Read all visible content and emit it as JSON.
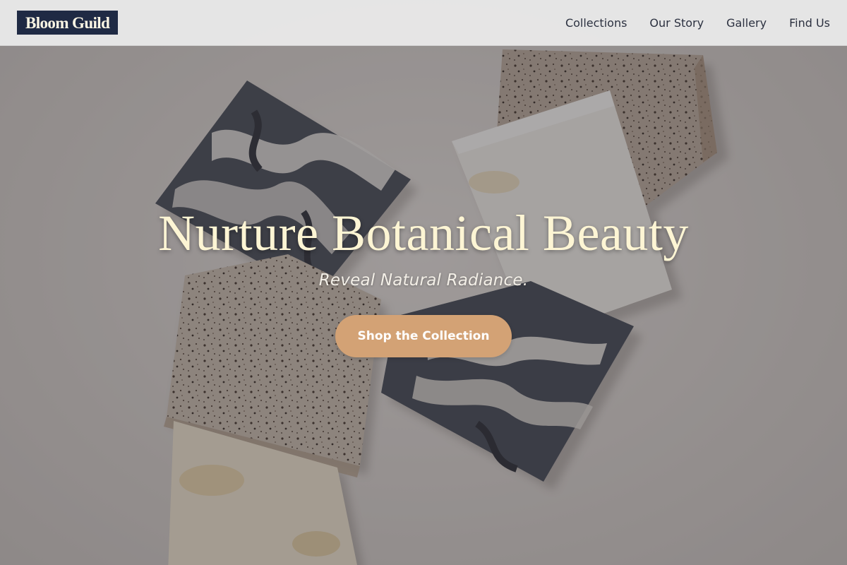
{
  "header": {
    "logo": "Bloom Guild",
    "nav": [
      {
        "label": "Collections"
      },
      {
        "label": "Our Story"
      },
      {
        "label": "Gallery"
      },
      {
        "label": "Find Us"
      }
    ]
  },
  "hero": {
    "title": "Nurture Botanical Beauty",
    "subtitle": "Reveal Natural Radiance.",
    "cta": "Shop the Collection",
    "image": "handmade-soap-bars-photo"
  },
  "colors": {
    "logo_bg": "#1f2a44",
    "logo_text": "#fbf6e4",
    "title": "#fdf5d4",
    "cta_bg": "#d3a275",
    "nav_text": "#2c3140"
  }
}
